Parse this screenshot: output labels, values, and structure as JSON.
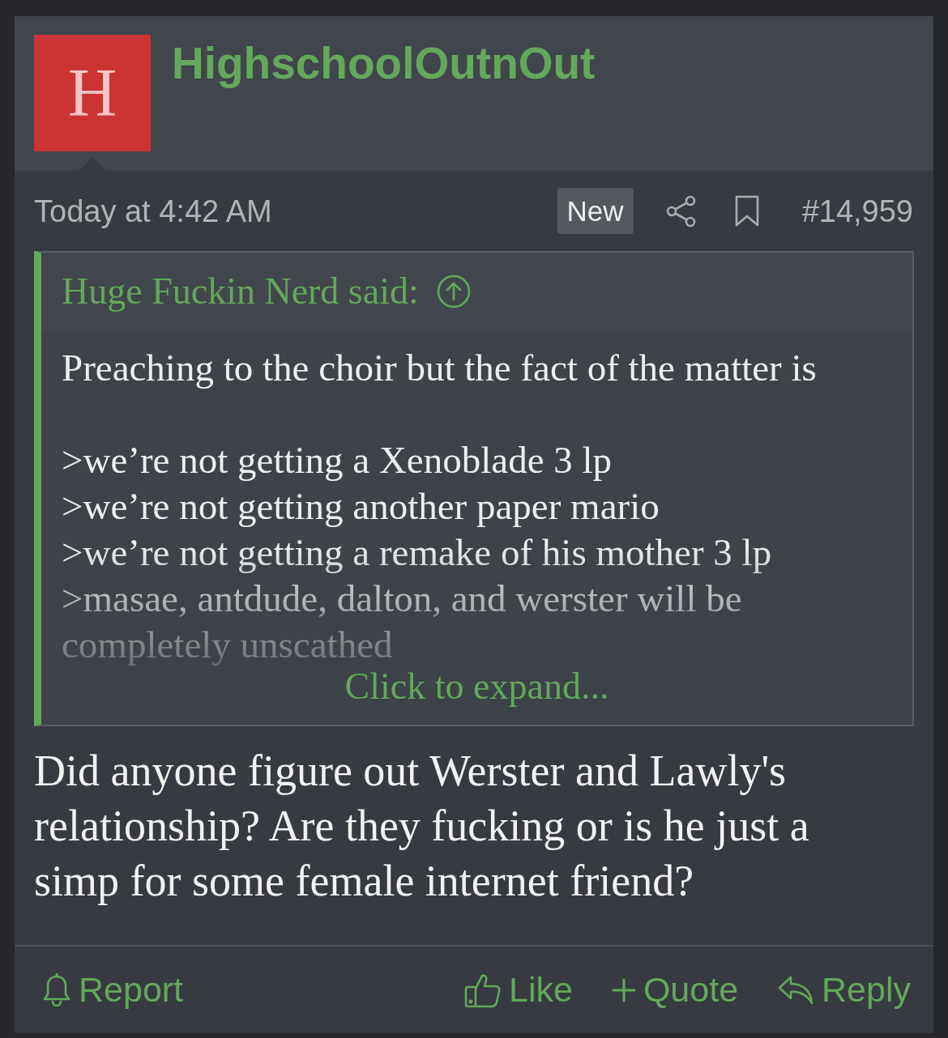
{
  "post": {
    "author": {
      "name": "HighschoolOutnOut",
      "avatar_letter": "H"
    },
    "timestamp": "Today at 4:42 AM",
    "new_label": "New",
    "post_number": "#14,959",
    "quote": {
      "attribution": "Huge Fuckin Nerd said:",
      "paragraphs": [
        {
          "lines": [
            "Preaching to the choir but the fact of the matter is"
          ]
        },
        {
          "lines": [
            ">we’re not getting a Xenoblade 3 lp",
            ">we’re not getting another paper mario",
            ">we’re not getting a remake of his mother 3 lp",
            ">masae, antdude, dalton, and werster will be completely unscathed"
          ]
        }
      ],
      "expanded": false,
      "expand_link": "Click to expand..."
    },
    "message": "Did anyone figure out Werster and Lawly's relationship? Are they fucking or is he just a simp for some female internet friend?",
    "actions": [
      {
        "kind": "report",
        "label": "Report"
      },
      {
        "kind": "like",
        "label": "Like"
      },
      {
        "kind": "quote",
        "label": "Quote"
      },
      {
        "kind": "reply",
        "label": "Reply"
      }
    ]
  }
}
